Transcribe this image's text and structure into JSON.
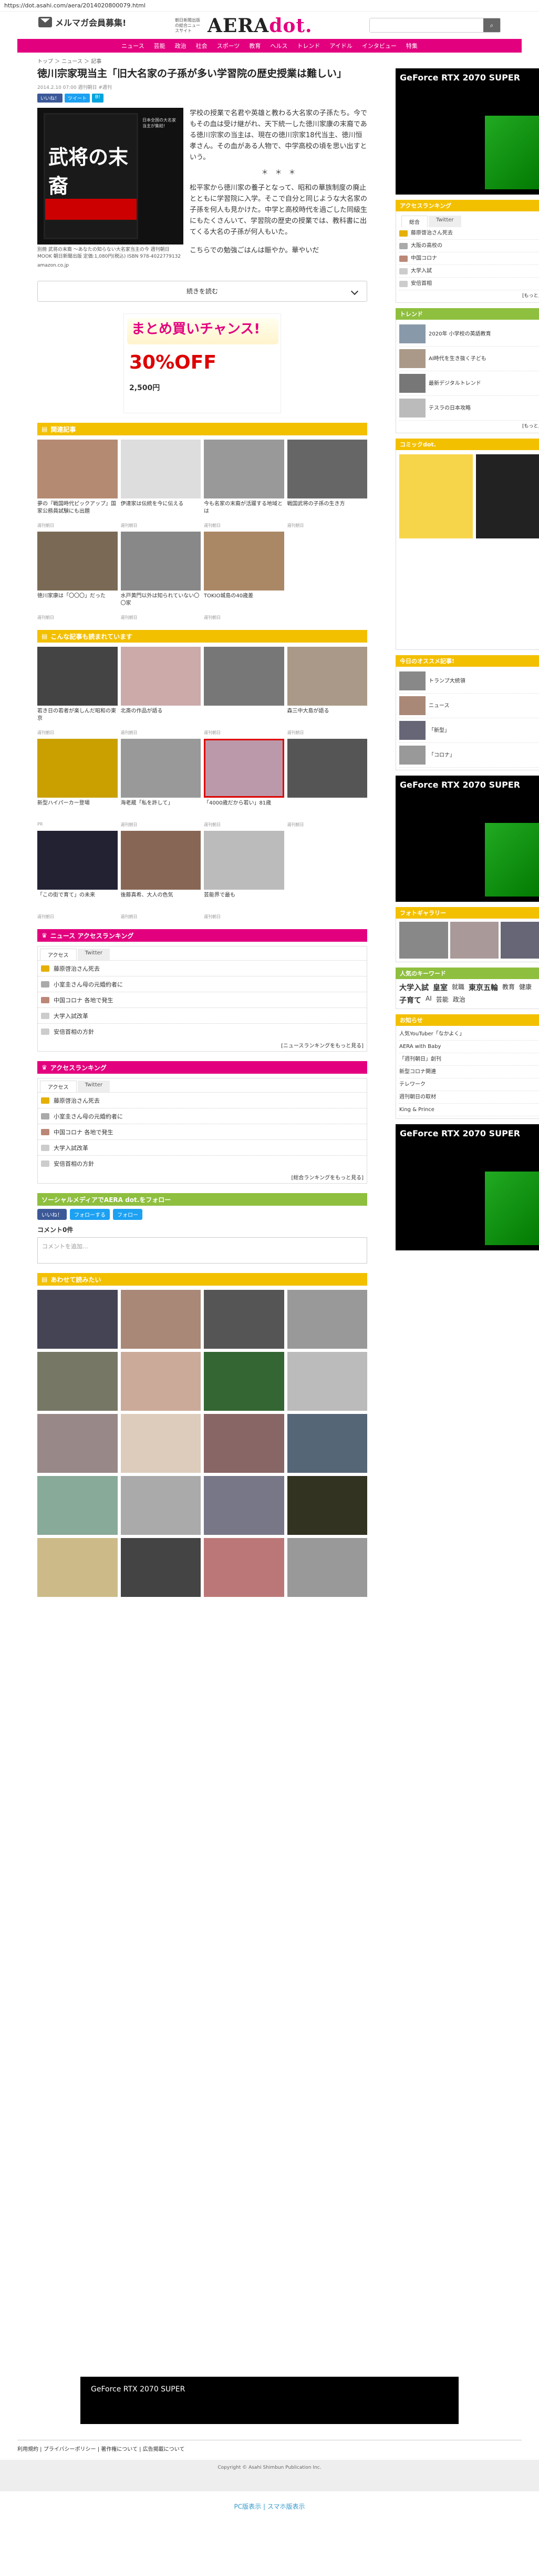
{
  "url": "https://dot.asahi.com/aera/2014020800079.html",
  "header": {
    "mail": "メルマガ会員募集!",
    "logo_small": "朝日新聞出版の総合ニュースサイト",
    "logo": "AERA",
    "logo_dot": "dot.",
    "search_placeholder": ""
  },
  "nav": [
    "ニュース",
    "芸能",
    "政治",
    "社会",
    "スポーツ",
    "教育",
    "ヘルス",
    "トレンド",
    "アイドル",
    "インタビュー",
    "特集"
  ],
  "breadcrumb": "トップ ＞ ニュース ＞ 記事",
  "title": "徳川宗家現当主「旧大名家の子孫が多い学習院の歴史授業は難しい」",
  "meta": "2014.2.10 07:00 週刊朝日 #週刊",
  "social": [
    "いいね！",
    "ツイート",
    "B!"
  ],
  "article": {
    "cover_title": "武将の末裔",
    "side_text": "日本全国の大名家当主が集結!",
    "caption": "別冊 武将の末裔 〜あなたの知らない大名家当主の今 週刊朝日 MOOK 朝日新聞出版 定価:1,080円(税込) ISBN 978-4022779132",
    "source": "amazon.co.jp",
    "p1": "学校の授業で名君や英雄と教わる大名家の子孫たち。今でもその血は受け継がれ、天下統一した徳川家康の末裔である徳川宗家の当主は、現在の徳川宗家18代当主、徳川恒孝さん。その血がある人物で、中学高校の頃を思い出すという。",
    "p2": "＊　＊　＊",
    "p3": "松平家から徳川家の養子となって、昭和の華族制度の廃止とともに学習院に入学。そこで自分と同じような大名家の子孫を何人も見かけた。中学と高校時代を過ごした同級生にもたくさんいて、学習院の歴史の授業では、教科書に出てくる大名の子孫が何人もいた。",
    "p4": "こちらでの勉強ごはんは賑やか。華やいだ"
  },
  "more": "続きを読む",
  "ad1": {
    "title": "まとめ買いチャンス!",
    "percent": "30%OFF",
    "note": "2,500円"
  },
  "section_related": "関連記事",
  "related": [
    {
      "t": "夢の『戦国時代ピックアップ』国家公務員試験にも出題",
      "d": "週刊朝日"
    },
    {
      "t": "伊達家は伝統を今に伝える",
      "d": "週刊朝日"
    },
    {
      "t": "今も名家の末裔が活躍する地域とは",
      "d": "週刊朝日"
    },
    {
      "t": "戦国武将の子孫の生き方",
      "d": "週刊朝日"
    },
    {
      "t": "徳川家康は「〇〇〇」だった",
      "d": "週刊朝日"
    },
    {
      "t": "水戸黄門以外は知られていない〇〇家",
      "d": "週刊朝日"
    },
    {
      "t": "TOKIO城島の40歳差",
      "d": "週刊朝日"
    },
    {
      "t": "",
      "d": ""
    }
  ],
  "section_recommend": "こんな記事も読まれています",
  "recommend": [
    {
      "t": "若き日の若者が楽しんだ昭和の東京",
      "d": "週刊朝日"
    },
    {
      "t": "北斎の作品が語る",
      "d": "週刊朝日"
    },
    {
      "t": "",
      "d": "週刊朝日"
    },
    {
      "t": "森三中大島が語る",
      "d": "週刊朝日"
    },
    {
      "t": "新型ハイパーカー登場",
      "d": "PR"
    },
    {
      "t": "海老蔵「私を許して」",
      "d": "週刊朝日"
    },
    {
      "t": "「4000歳だから若い」81歳",
      "d": "週刊朝日"
    },
    {
      "t": "",
      "d": "週刊朝日"
    },
    {
      "t": "「この街で育て」の未来",
      "d": "週刊朝日"
    },
    {
      "t": "後藤真希、大人の色気",
      "d": "週刊朝日"
    },
    {
      "t": "芸能界で最も",
      "d": "週刊朝日"
    },
    {
      "t": "",
      "d": ""
    }
  ],
  "section_rank": "ニュース アクセスランキング",
  "rank_tabs": [
    "アクセス",
    "Twitter"
  ],
  "rank": [
    "藤原啓治さん死去",
    "小室圭さん母の元婚約者に",
    "中国コロナ 各地で発生",
    "大学入試改革",
    "安倍首相の方針"
  ],
  "rank_more": "[ニュースランキングをもっと見る]",
  "section_rank2": "アクセスランキング",
  "rank2": [
    "藤原啓治さん死去",
    "小室圭さん母の元婚約者に",
    "中国コロナ 各地で発生",
    "大学入試改革",
    "安倍首相の方針"
  ],
  "rank2_more": "[総合ランキングをもっと見る]",
  "section_follow": "ソーシャルメディアでAERA dot.をフォロー",
  "follow": [
    "いいね！",
    "フォローする",
    "フォロー"
  ],
  "comment_label": "コメント0件",
  "comment_placeholder": "コメントを追加...",
  "section_more": "あわせて読みたい",
  "side": {
    "rank_hd": "アクセスランキング",
    "rank_tabs": [
      "総合",
      "Twitter"
    ],
    "rank": [
      "藤原啓治さん死去",
      "大阪の高校の",
      "中国コロナ",
      "大学入試",
      "安倍首相"
    ],
    "rank_more": "[もっと見る]",
    "trend_hd": "トレンド",
    "trend": [
      "2020年 小学校の英語教育",
      "AI時代を生き抜く子ども",
      "最新デジタルトレンド",
      "テスラの日本攻略"
    ],
    "trend_more": "[もっと見る]",
    "comic_hd": "コミックdot.",
    "pick_hd": "今日のオススメ記事!",
    "picks": [
      "トランプ大統領",
      "ニュース",
      "「新型」",
      "「コロナ」"
    ],
    "photo_hd": "フォトギャラリー",
    "tags_hd": "人気のキーワード",
    "tags": [
      "大学入試",
      "皇室",
      "就職",
      "東京五輪",
      "教育",
      "健康",
      "子育て",
      "AI",
      "芸能",
      "政治"
    ],
    "notice_hd": "お知らせ",
    "notice": [
      "人気YouTuber「なかよく」",
      "AERA with Baby",
      "「週刊朝日」創刊",
      "新型コロナ関連",
      "テレワーク",
      "週刊朝日の取材",
      "King & Prince"
    ]
  },
  "footer": {
    "banner": "GeForce RTX 2070 SUPER",
    "links": "利用規約 | プライバシーポリシー | 著作権について | 広告掲載について",
    "copyright": "Copyright © Asahi Shimbun Publication Inc.",
    "switch": "PC版表示 | スマホ版表示"
  }
}
